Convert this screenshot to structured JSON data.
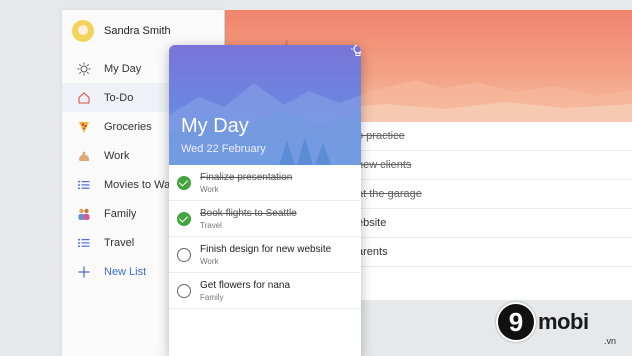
{
  "profile": {
    "name": "Sandra Smith"
  },
  "sidebar": {
    "items": [
      {
        "label": "My Day",
        "icon": "sun-icon"
      },
      {
        "label": "To-Do",
        "icon": "home-icon",
        "active": true
      },
      {
        "label": "Groceries",
        "icon": "pizza-icon"
      },
      {
        "label": "Work",
        "icon": "flexed-arm-icon"
      },
      {
        "label": "Movies to Wat",
        "icon": "list-icon"
      },
      {
        "label": "Family",
        "icon": "family-icon"
      },
      {
        "label": "Travel",
        "icon": "list-icon"
      },
      {
        "label": "New List",
        "icon": "plus-icon"
      }
    ]
  },
  "panel": {
    "title": "My Day",
    "date": "Wed 22 February",
    "tasks": [
      {
        "title": "Finalize presentation",
        "list": "Work",
        "done": true
      },
      {
        "title": "Book flights to Seattle",
        "list": "Travel",
        "done": true
      },
      {
        "title": "Finish design for new website",
        "list": "Work",
        "done": false
      },
      {
        "title": "Get flowers for nana",
        "list": "Family",
        "done": false
      }
    ]
  },
  "background_list": {
    "rows": [
      {
        "text": "o practice",
        "done": true
      },
      {
        "text": "new clients",
        "done": true
      },
      {
        "text": "at the garage",
        "done": true
      },
      {
        "text": "ebsite",
        "done": false
      },
      {
        "text": "arents",
        "done": false
      }
    ]
  },
  "watermark": {
    "digit": "9",
    "text": "mobi",
    "domain": ".vn"
  },
  "colors": {
    "accent": "#3b6fd0",
    "check_done": "#44a43e",
    "header_top": "#7a74d8",
    "header_bottom": "#5fa0de",
    "bg_header": "#f0856e"
  }
}
